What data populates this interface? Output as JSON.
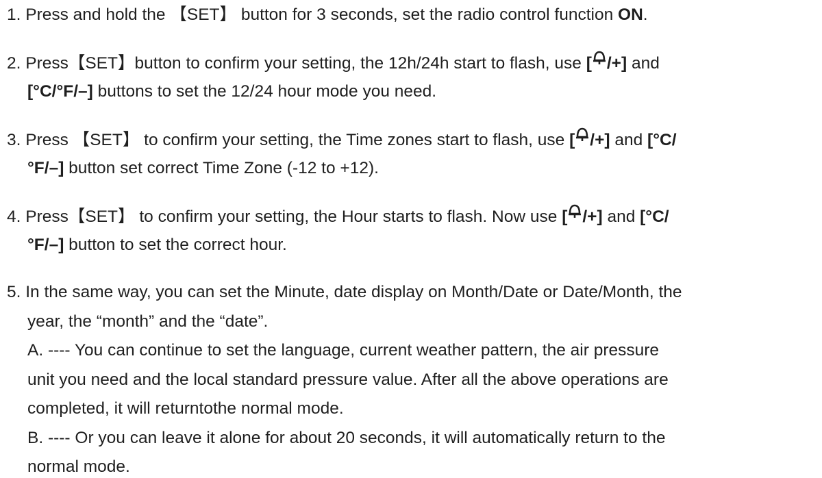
{
  "steps": [
    {
      "num": "1.",
      "l1a": "Press and hold the 【SET】 button for 3 seconds, set the radio control function ",
      "l1b": "ON",
      "l1c": "."
    },
    {
      "num": "2.",
      "l1a": "Press【SET】button to confirm your setting, the 12h/24h start to flash, use ",
      "l1b_open": "[",
      "l1b_close": "/+]",
      "l1c": " and",
      "l2a": "[°C/°F/–]",
      "l2b": " buttons to set the 12/24 hour mode you need."
    },
    {
      "num": "3.",
      "l1a": "Press 【SET】 to confirm your setting, the Time zones start to flash, use ",
      "l1b_open": "[",
      "l1b_close": "/+]",
      "l1c": " and ",
      "l1d": "[°C/",
      "l2a": "°F/–]",
      "l2b": " button set correct Time Zone (-12 to +12)."
    },
    {
      "num": "4.",
      "l1a": "Press【SET】 to confirm your setting, the Hour starts to flash. Now use ",
      "l1b_open": "[",
      "l1b_close": "/+]",
      "l1c": " and ",
      "l1d": "[°C/",
      "l2a": "°F/–]",
      "l2b": " button to set the correct hour."
    },
    {
      "num": "5.",
      "l1": "In the same way, you can set the Minute, date display on Month/Date or Date/Month, the",
      "l2": "year, the “month” and the “date”.",
      "a1": "A. ---- You can continue to set the language, current weather pattern, the air pressure",
      "a2": "unit you need and the local standard pressure value. After all the above operations are",
      "a3": "completed, it will returntothe normal mode.",
      "b1": "B. ---- Or you can leave it alone for about 20 seconds, it will automatically return to the",
      "b2": "normal mode."
    }
  ]
}
